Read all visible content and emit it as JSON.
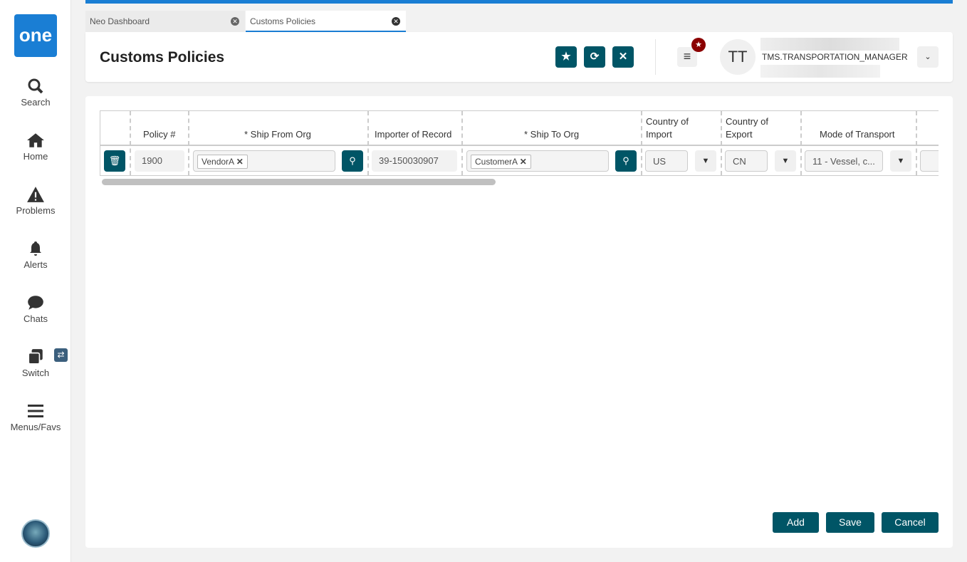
{
  "sidebar": {
    "logo": "one",
    "items": [
      {
        "label": "Search"
      },
      {
        "label": "Home"
      },
      {
        "label": "Problems"
      },
      {
        "label": "Alerts"
      },
      {
        "label": "Chats"
      },
      {
        "label": "Switch"
      },
      {
        "label": "Menus/Favs"
      }
    ]
  },
  "tabs": [
    {
      "label": "Neo Dashboard"
    },
    {
      "label": "Customs Policies"
    }
  ],
  "header": {
    "title": "Customs Policies",
    "user_initials": "TT",
    "user_role": "TMS.TRANSPORTATION_MANAGER"
  },
  "grid": {
    "columns": [
      "Policy #",
      "* Ship From Org",
      "Importer of Record",
      "* Ship To Org",
      "Country of Import",
      "Country of Export",
      "Mode of Transport"
    ],
    "row": {
      "policy": "1900",
      "ship_from": "VendorA",
      "importer": "39-150030907",
      "ship_to": "CustomerA",
      "country_import": "US",
      "country_export": "CN",
      "mode": "11 - Vessel, c..."
    }
  },
  "actions": {
    "add": "Add",
    "save": "Save",
    "cancel": "Cancel"
  }
}
